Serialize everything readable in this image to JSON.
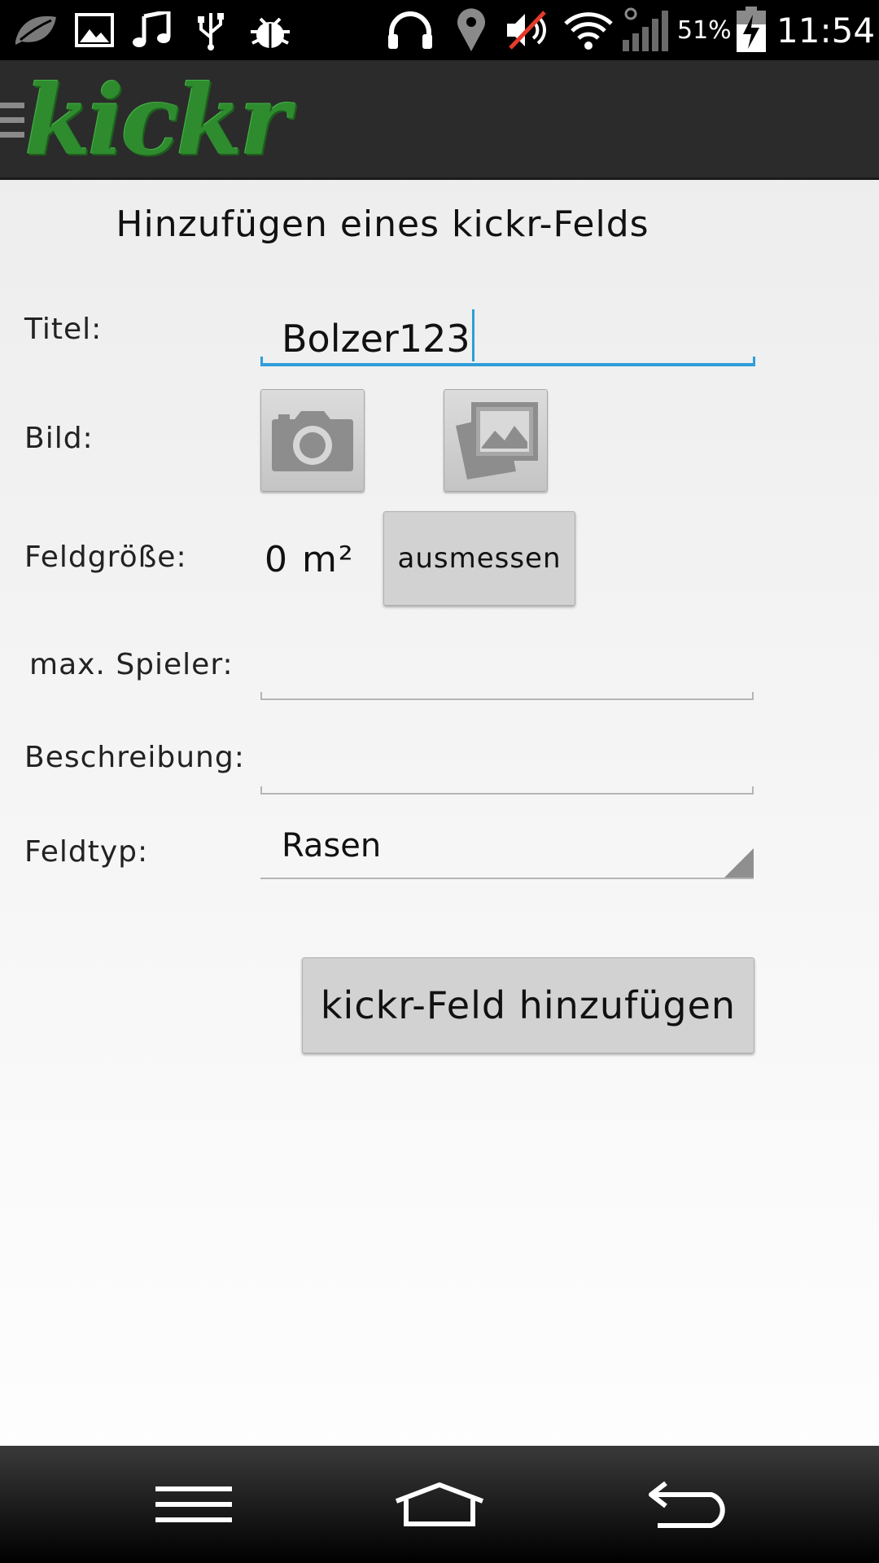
{
  "status_bar": {
    "battery_percent": "51%",
    "time": "11:54",
    "left_icons": [
      "leaf-icon",
      "image-icon",
      "music-icon",
      "usb-icon",
      "bug-icon"
    ],
    "right_icons": [
      "headphones-icon",
      "location-icon",
      "volume-muted-icon",
      "wifi-icon",
      "signal-icon",
      "battery-charging-icon"
    ]
  },
  "action_bar": {
    "logo_text": "kickr",
    "drawer_icon": "drawer-icon"
  },
  "form": {
    "heading": "Hinzufügen eines kickr-Felds",
    "title_label": "Titel:",
    "title_value": "Bolzer123",
    "image_label": "Bild:",
    "image_buttons": [
      "camera-icon",
      "gallery-icon"
    ],
    "size_label": "Feldgröße:",
    "size_value": "0 m²",
    "measure_button": "ausmessen",
    "max_players_label": "max. Spieler:",
    "max_players_value": "",
    "description_label": "Beschreibung:",
    "description_value": "",
    "field_type_label": "Feldtyp:",
    "field_type_value": "Rasen",
    "submit_button": "kickr-Feld hinzufügen"
  },
  "nav_bar": {
    "icons": [
      "menu-icon",
      "home-icon",
      "back-icon"
    ]
  },
  "colors": {
    "accent": "#2e9ed8",
    "logo_green": "#2e8b2e",
    "action_bar": "#2b2b2b"
  }
}
